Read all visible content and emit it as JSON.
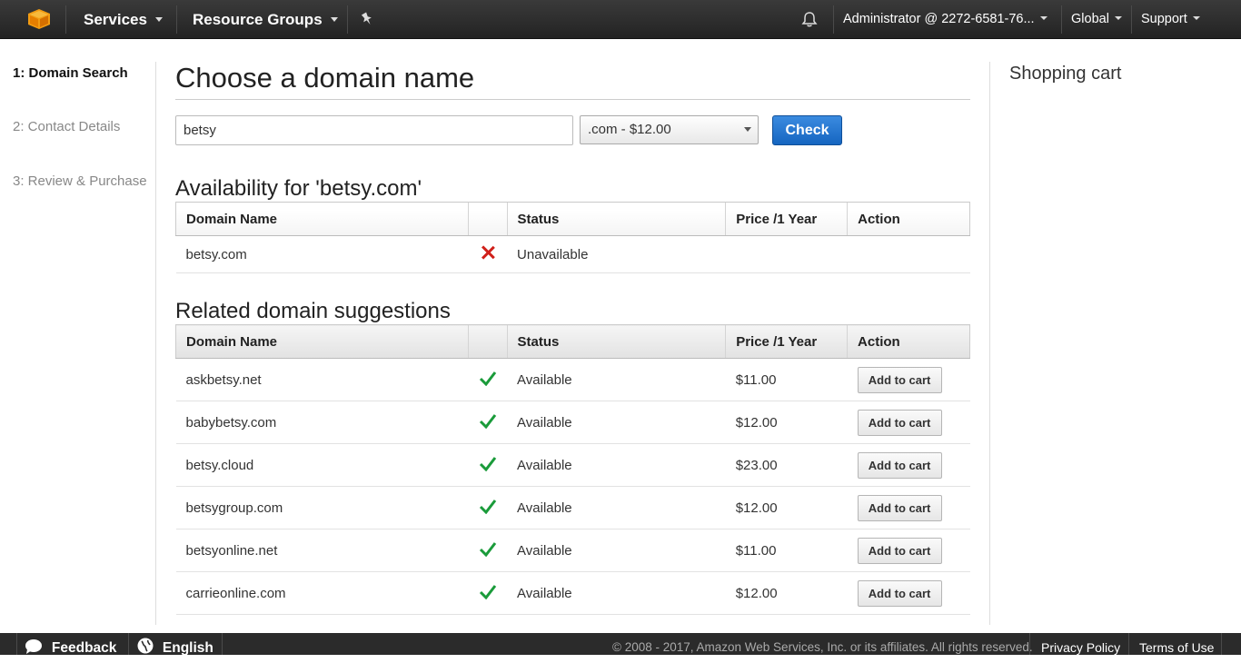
{
  "topnav": {
    "services_label": "Services",
    "resource_groups_label": "Resource Groups",
    "account_label": "Administrator @ 2272-6581-76...",
    "region_label": "Global",
    "support_label": "Support",
    "icons": [
      "aws-logo-icon",
      "pin-icon",
      "bell-icon"
    ]
  },
  "steps": [
    {
      "label": "1: Domain Search"
    },
    {
      "label": "2: Contact Details"
    },
    {
      "label": "3: Review & Purchase"
    }
  ],
  "main": {
    "title": "Choose a domain name",
    "search_value": "betsy",
    "tld_selected": ".com - $12.00",
    "check_label": "Check",
    "availability_title": "Availability for 'betsy.com'",
    "suggestions_title": "Related domain suggestions",
    "columns": {
      "domain": "Domain Name",
      "status": "Status",
      "price": "Price /1 Year",
      "action": "Action"
    },
    "availability": [
      {
        "domain": "betsy.com",
        "status": "Unavailable"
      }
    ],
    "suggestions": [
      {
        "domain": "askbetsy.net",
        "status": "Available",
        "price": "$11.00",
        "action": "Add to cart"
      },
      {
        "domain": "babybetsy.com",
        "status": "Available",
        "price": "$12.00",
        "action": "Add to cart"
      },
      {
        "domain": "betsy.cloud",
        "status": "Available",
        "price": "$23.00",
        "action": "Add to cart"
      },
      {
        "domain": "betsygroup.com",
        "status": "Available",
        "price": "$12.00",
        "action": "Add to cart"
      },
      {
        "domain": "betsyonline.net",
        "status": "Available",
        "price": "$11.00",
        "action": "Add to cart"
      },
      {
        "domain": "carrieonline.com",
        "status": "Available",
        "price": "$12.00",
        "action": "Add to cart"
      }
    ]
  },
  "cart": {
    "title": "Shopping cart"
  },
  "footer": {
    "feedback_label": "Feedback",
    "language_label": "English",
    "copyright": "© 2008 - 2017, Amazon Web Services, Inc. or its affiliates. All rights reserved.",
    "privacy_label": "Privacy Policy",
    "terms_label": "Terms of Use"
  },
  "colors": {
    "nav_bg": "#232323",
    "primary_button": "#1565c0",
    "available": "#1a9b3a",
    "unavailable": "#d0201a"
  }
}
